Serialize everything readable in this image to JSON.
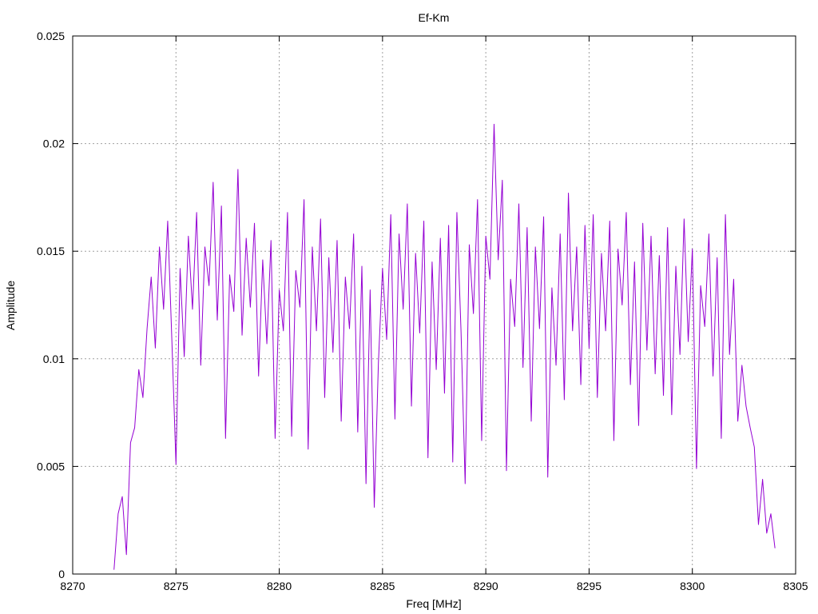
{
  "chart_data": {
    "type": "line",
    "title": "Ef-Km",
    "xlabel": "Freq [MHz]",
    "ylabel": "Amplitude",
    "xlim": [
      8270,
      8305
    ],
    "ylim": [
      0,
      0.025
    ],
    "grid": true,
    "xticks": [
      8270,
      8275,
      8280,
      8285,
      8290,
      8295,
      8300,
      8305
    ],
    "xtick_labels": [
      "8270",
      "8275",
      "8280",
      "8285",
      "8290",
      "8295",
      "8300",
      "8305"
    ],
    "yticks": [
      0,
      0.005,
      0.01,
      0.015,
      0.02,
      0.025
    ],
    "ytick_labels": [
      "0",
      "0.005",
      "0.01",
      "0.015",
      "0.02",
      "0.025"
    ],
    "series": [
      {
        "color": "#9400d3",
        "x": [
          8272.0,
          8272.2,
          8272.4,
          8272.6,
          8272.8,
          8273.0,
          8273.2,
          8273.4,
          8273.6,
          8273.8,
          8274.0,
          8274.2,
          8274.4,
          8274.6,
          8274.8,
          8275.0,
          8275.2,
          8275.4,
          8275.6,
          8275.8,
          8276.0,
          8276.2,
          8276.4,
          8276.6,
          8276.8,
          8277.0,
          8277.2,
          8277.4,
          8277.6,
          8277.8,
          8278.0,
          8278.2,
          8278.4,
          8278.6,
          8278.8,
          8279.0,
          8279.2,
          8279.4,
          8279.6,
          8279.8,
          8280.0,
          8280.2,
          8280.4,
          8280.6,
          8280.8,
          8281.0,
          8281.2,
          8281.4,
          8281.6,
          8281.8,
          8282.0,
          8282.2,
          8282.4,
          8282.6,
          8282.8,
          8283.0,
          8283.2,
          8283.4,
          8283.6,
          8283.8,
          8284.0,
          8284.2,
          8284.4,
          8284.6,
          8284.8,
          8285.0,
          8285.2,
          8285.4,
          8285.6,
          8285.8,
          8286.0,
          8286.2,
          8286.4,
          8286.6,
          8286.8,
          8287.0,
          8287.2,
          8287.4,
          8287.6,
          8287.8,
          8288.0,
          8288.2,
          8288.4,
          8288.6,
          8288.8,
          8289.0,
          8289.2,
          8289.4,
          8289.6,
          8289.8,
          8290.0,
          8290.2,
          8290.4,
          8290.6,
          8290.8,
          8291.0,
          8291.2,
          8291.4,
          8291.6,
          8291.8,
          8292.0,
          8292.2,
          8292.4,
          8292.6,
          8292.8,
          8293.0,
          8293.2,
          8293.4,
          8293.6,
          8293.8,
          8294.0,
          8294.2,
          8294.4,
          8294.6,
          8294.8,
          8295.0,
          8295.2,
          8295.4,
          8295.6,
          8295.8,
          8296.0,
          8296.2,
          8296.4,
          8296.6,
          8296.8,
          8297.0,
          8297.2,
          8297.4,
          8297.6,
          8297.8,
          8298.0,
          8298.2,
          8298.4,
          8298.6,
          8298.8,
          8299.0,
          8299.2,
          8299.4,
          8299.6,
          8299.8,
          8300.0,
          8300.2,
          8300.4,
          8300.6,
          8300.8,
          8301.0,
          8301.2,
          8301.4,
          8301.6,
          8301.8,
          8302.0,
          8302.2,
          8302.4,
          8302.6,
          8302.8,
          8303.0,
          8303.2,
          8303.4,
          8303.6,
          8303.8,
          8304.0
        ],
        "y": [
          0.0002,
          0.0028,
          0.0036,
          0.0009,
          0.0061,
          0.0068,
          0.0095,
          0.0082,
          0.0114,
          0.0138,
          0.0105,
          0.0152,
          0.0123,
          0.0164,
          0.0109,
          0.0051,
          0.0142,
          0.0101,
          0.0157,
          0.0123,
          0.0168,
          0.0097,
          0.0152,
          0.0134,
          0.0182,
          0.0118,
          0.0171,
          0.0063,
          0.0139,
          0.0122,
          0.0188,
          0.0111,
          0.0156,
          0.0124,
          0.0163,
          0.0092,
          0.0146,
          0.0107,
          0.0155,
          0.0063,
          0.0132,
          0.0113,
          0.0168,
          0.0064,
          0.0141,
          0.0124,
          0.0174,
          0.0058,
          0.0152,
          0.0113,
          0.0165,
          0.0082,
          0.0147,
          0.0103,
          0.0155,
          0.0071,
          0.0138,
          0.0114,
          0.0158,
          0.0066,
          0.0143,
          0.0042,
          0.0132,
          0.0031,
          0.0098,
          0.0142,
          0.0109,
          0.0167,
          0.0072,
          0.0158,
          0.0123,
          0.0172,
          0.0078,
          0.0149,
          0.0112,
          0.0164,
          0.0054,
          0.0145,
          0.0095,
          0.0156,
          0.0084,
          0.0162,
          0.0052,
          0.0168,
          0.0113,
          0.0042,
          0.0153,
          0.0121,
          0.0174,
          0.0062,
          0.0157,
          0.0137,
          0.0209,
          0.0146,
          0.0183,
          0.0048,
          0.0137,
          0.0115,
          0.0172,
          0.0096,
          0.0161,
          0.0071,
          0.0152,
          0.0114,
          0.0166,
          0.0045,
          0.0133,
          0.0097,
          0.0158,
          0.0081,
          0.0177,
          0.0113,
          0.0152,
          0.0088,
          0.0162,
          0.0105,
          0.0167,
          0.0082,
          0.0149,
          0.0113,
          0.0164,
          0.0062,
          0.0151,
          0.0125,
          0.0168,
          0.0088,
          0.0145,
          0.0069,
          0.0163,
          0.0104,
          0.0157,
          0.0093,
          0.0148,
          0.0083,
          0.0161,
          0.0074,
          0.0143,
          0.0102,
          0.0165,
          0.0108,
          0.0151,
          0.0049,
          0.0134,
          0.0115,
          0.0158,
          0.0092,
          0.0147,
          0.0063,
          0.0167,
          0.0102,
          0.0137,
          0.0071,
          0.0097,
          0.0078,
          0.0068,
          0.0059,
          0.0023,
          0.0044,
          0.0019,
          0.0028,
          0.0012
        ]
      }
    ]
  }
}
